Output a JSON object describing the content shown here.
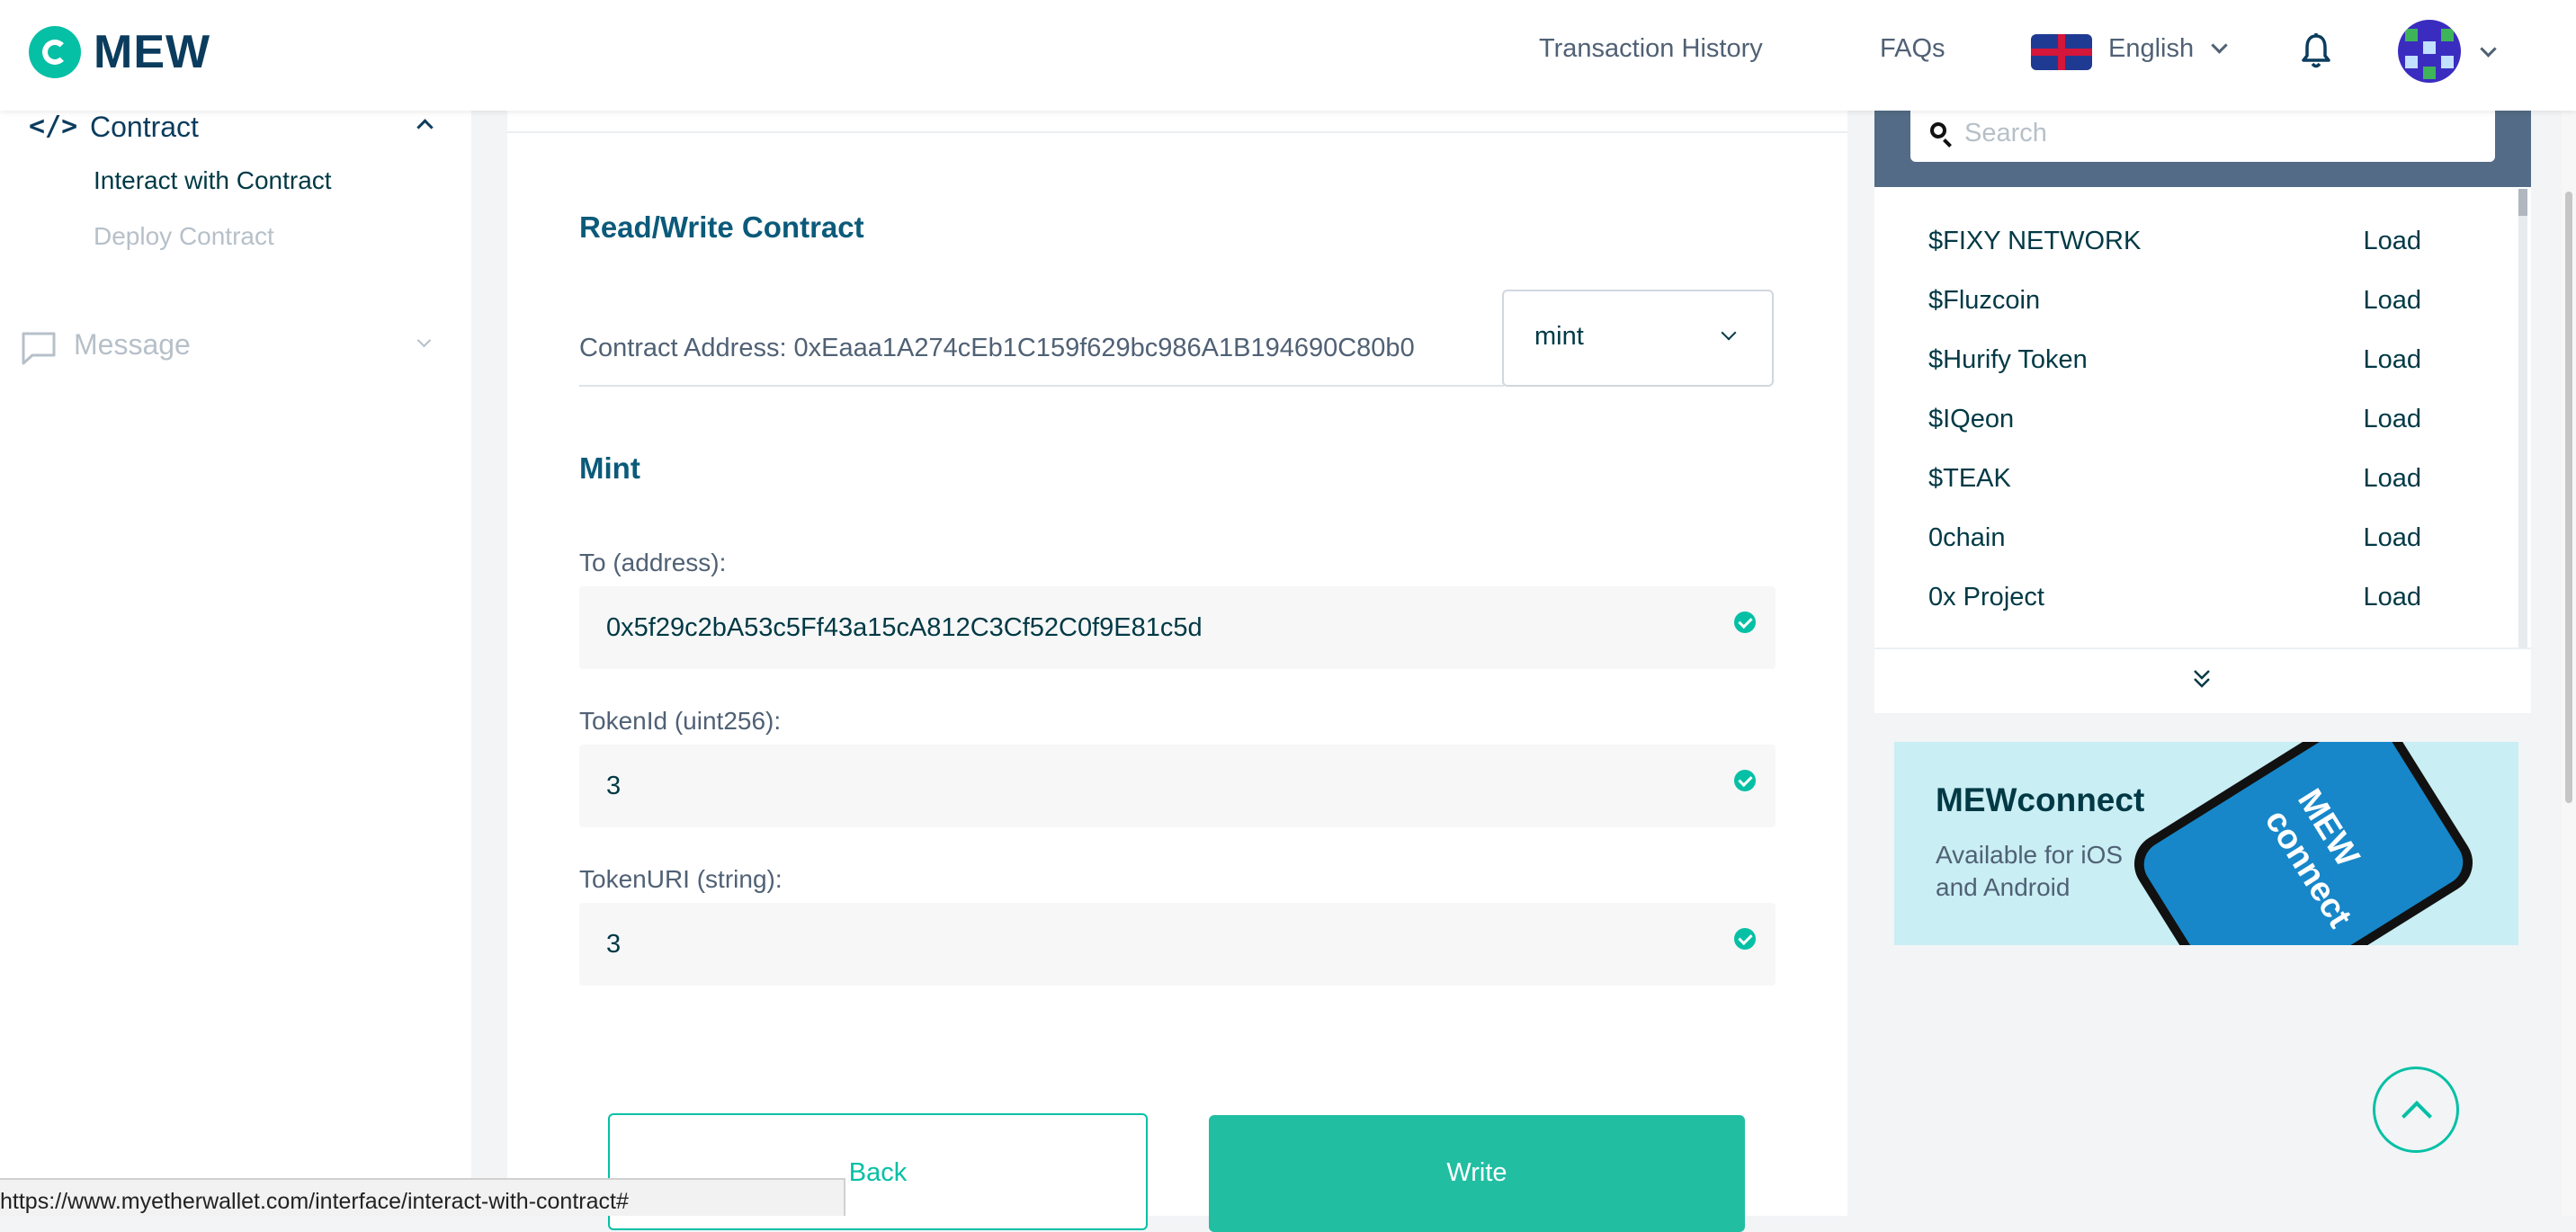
{
  "header": {
    "logo_text": "MEW",
    "nav": [
      "Transaction History",
      "FAQs"
    ],
    "language": "English"
  },
  "sidebar": {
    "contract": {
      "label": "Contract",
      "items": [
        "Interact with Contract",
        "Deploy Contract"
      ]
    },
    "message": {
      "label": "Message"
    }
  },
  "main": {
    "title": "Read/Write Contract",
    "contract_address": "Contract Address: 0xEaaa1A274cEb1C159f629bc986A1B194690C80b0",
    "method_select": "mint",
    "section_title": "Mint",
    "fields": [
      {
        "label": "To (address):",
        "value": "0x5f29c2bA53c5Ff43a15cA812C3Cf52C0f9E81c5d"
      },
      {
        "label": "TokenId (uint256):",
        "value": "3"
      },
      {
        "label": "TokenURI (string):",
        "value": "3"
      }
    ],
    "back_label": "Back",
    "write_label": "Write"
  },
  "tokens": {
    "search_placeholder": "Search",
    "load_label": "Load",
    "list": [
      "$FIXY NETWORK",
      "$Fluzcoin",
      "$Hurify Token",
      "$IQeon",
      "$TEAK",
      "0chain",
      "0x Project"
    ]
  },
  "promo": {
    "title": "MEWconnect",
    "subtitle": "Available for iOS and Android",
    "phone_text": "MEW connect"
  },
  "status_url": "https://www.myetherwallet.com/interface/interact-with-contract#",
  "colors": {
    "accent": "#05c0a5",
    "header_bar": "#536b86",
    "primary_text": "#003945"
  }
}
